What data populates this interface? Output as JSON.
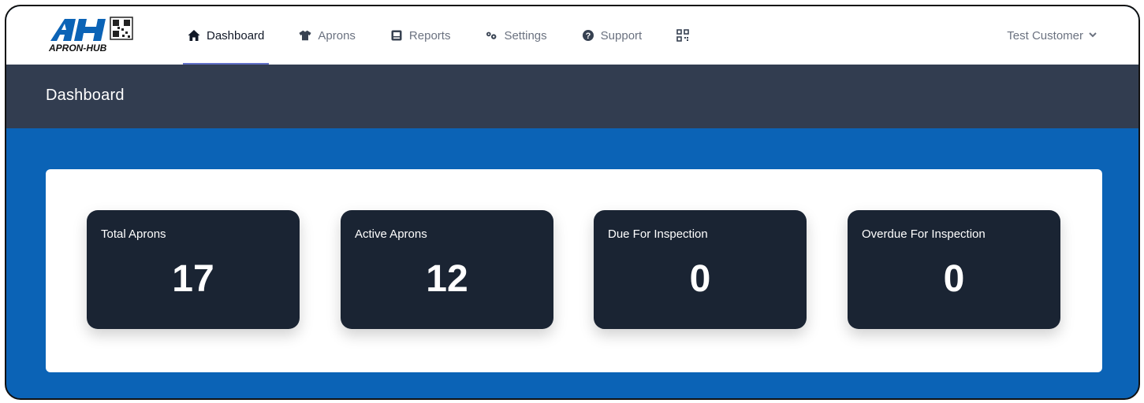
{
  "brand": {
    "name": "APRON-HUB",
    "mark": "AH"
  },
  "nav": {
    "items": [
      {
        "label": "Dashboard",
        "icon": "home-icon",
        "active": true
      },
      {
        "label": "Aprons",
        "icon": "shirt-icon",
        "active": false
      },
      {
        "label": "Reports",
        "icon": "report-icon",
        "active": false
      },
      {
        "label": "Settings",
        "icon": "gears-icon",
        "active": false
      },
      {
        "label": "Support",
        "icon": "question-circle-icon",
        "active": false
      },
      {
        "label": "",
        "icon": "qr-code-icon",
        "active": false
      }
    ],
    "user": {
      "label": "Test Customer",
      "icon": "chevron-down-icon"
    }
  },
  "header": {
    "title": "Dashboard"
  },
  "stats": [
    {
      "label": "Total Aprons",
      "value": "17"
    },
    {
      "label": "Active Aprons",
      "value": "12"
    },
    {
      "label": "Due For Inspection",
      "value": "0"
    },
    {
      "label": "Overdue For Inspection",
      "value": "0"
    }
  ],
  "colors": {
    "header_bg": "#323d50",
    "page_bg": "#0b63b6",
    "card_bg": "#1a2433",
    "active_underline": "#6271c9"
  }
}
